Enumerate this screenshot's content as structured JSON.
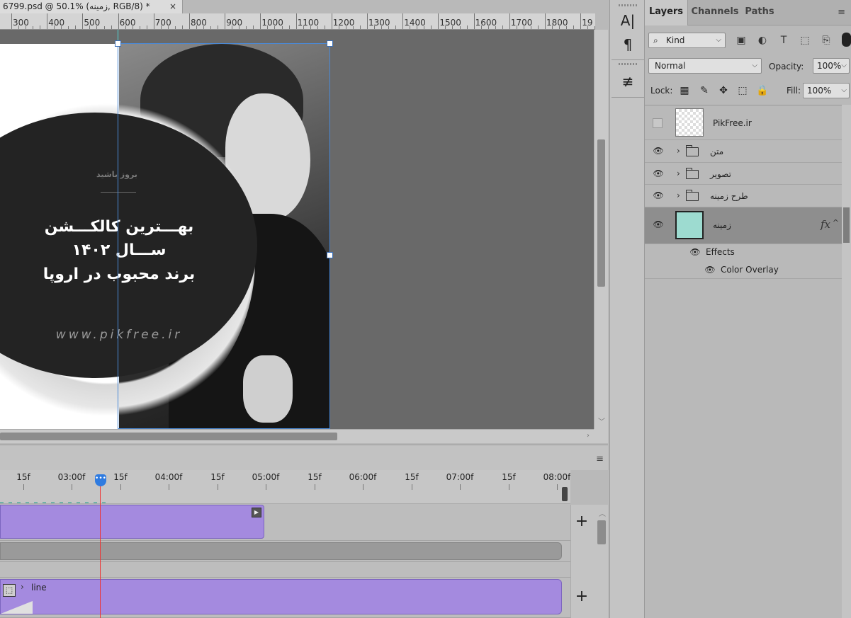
{
  "document": {
    "tab_title": "6799.psd @ 50.1% (زمینه, RGB/8) *",
    "close_glyph": "×"
  },
  "ruler": {
    "labels": [
      "300",
      "400",
      "500",
      "600",
      "700",
      "800",
      "900",
      "1000",
      "1100",
      "1200",
      "1300",
      "1400",
      "1500",
      "1600",
      "1700",
      "1800",
      "19"
    ]
  },
  "artboard": {
    "small_label": "بروز باشید",
    "headline_lines": [
      "بهـــترین کالکـــشن",
      "ســـال ۱۴۰۲",
      "برند محبوب در اروپا"
    ],
    "website": "www.pikfree.ir"
  },
  "timeline": {
    "time_labels": [
      "15f",
      "03:00f",
      "15f",
      "04:00f",
      "15f",
      "05:00f",
      "15f",
      "06:00f",
      "15f",
      "07:00f",
      "15f",
      "08:00f"
    ],
    "playhead_glyph": "•••",
    "clip_layer_label": "line",
    "menu_icon": "≡"
  },
  "tools": {
    "char_icon": "A|",
    "para_icon": "¶",
    "adjust_icon": "≢"
  },
  "layers_panel": {
    "tabs": [
      {
        "label": "Layers",
        "active": true
      },
      {
        "label": "Channels",
        "active": false
      },
      {
        "label": "Paths",
        "active": false
      }
    ],
    "filter": {
      "kind_label": "Kind"
    },
    "blend_mode": "Normal",
    "opacity_label": "Opacity:",
    "opacity_value": "100%",
    "lock_label": "Lock:",
    "fill_label": "Fill:",
    "fill_value": "100%",
    "layers": [
      {
        "name": "PikFree.ir",
        "type": "pixel",
        "visible": false
      },
      {
        "name": "متن",
        "type": "group",
        "visible": true
      },
      {
        "name": "تصویر",
        "type": "group",
        "visible": true
      },
      {
        "name": "طرح زمینه",
        "type": "group",
        "visible": true
      },
      {
        "name": "زمینه",
        "type": "shape",
        "visible": true,
        "selected": true,
        "thumb_color": "#9ddbd0",
        "fx": "fx"
      }
    ],
    "effects_label": "Effects",
    "effect_item": "Color Overlay"
  },
  "colors": {
    "accent_blue": "#2f7be0",
    "clip_purple": "#a48adf",
    "guide_cyan": "#4fd6d6",
    "layer_thumb_teal": "#9ddbd0"
  }
}
